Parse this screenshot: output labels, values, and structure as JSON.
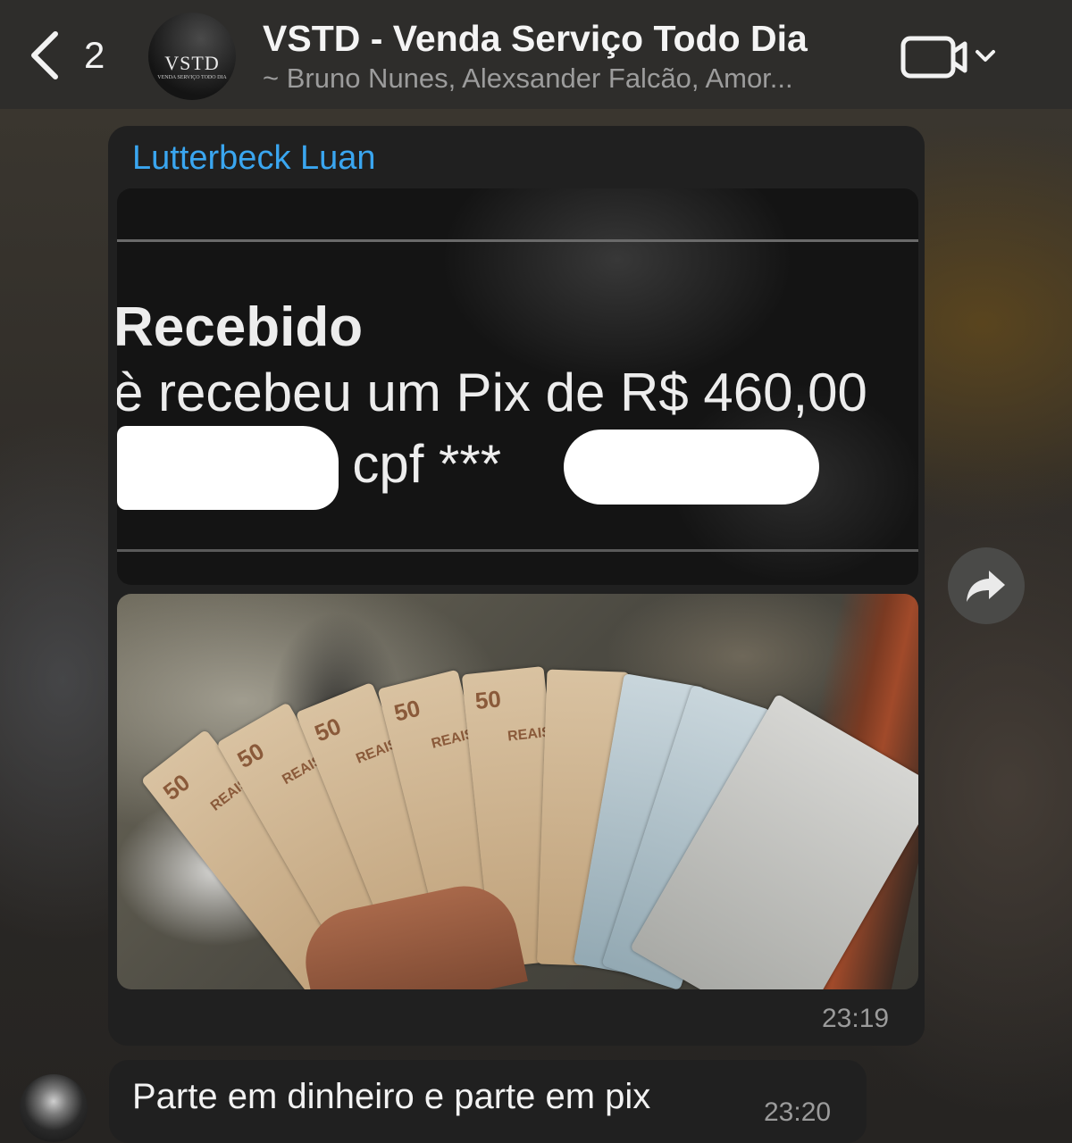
{
  "header": {
    "back_count": "2",
    "group_name": "VSTD - Venda Serviço Todo Dia",
    "members": "~ Bruno Nunes, Alexsander Falcão, Amor...",
    "avatar_logo": "VSTD",
    "avatar_logo_sub": "VENDA SERVIÇO TODO DIA",
    "back_icon": "chevron-left-icon",
    "video_icon": "video-camera-icon",
    "dropdown_icon": "chevron-down-icon"
  },
  "messages": [
    {
      "sender": "Lutterbeck Luan",
      "sender_color": "#3aa6f0",
      "image1": {
        "line1": "Recebido",
        "line2": "è recebeu um Pix de R$ 460,00",
        "line3": "s, cpf ***"
      },
      "image2": {
        "note_label_50": "50",
        "note_label_reais": "REAIS"
      },
      "time": "23:19"
    },
    {
      "text": "Parte em dinheiro e parte em pix",
      "time": "23:20"
    }
  ],
  "forward_icon": "share-arrow-icon",
  "colors": {
    "header_bg": "#2e2d2b",
    "bubble_bg": "#202020",
    "timestamp": "#9b9b9b"
  }
}
